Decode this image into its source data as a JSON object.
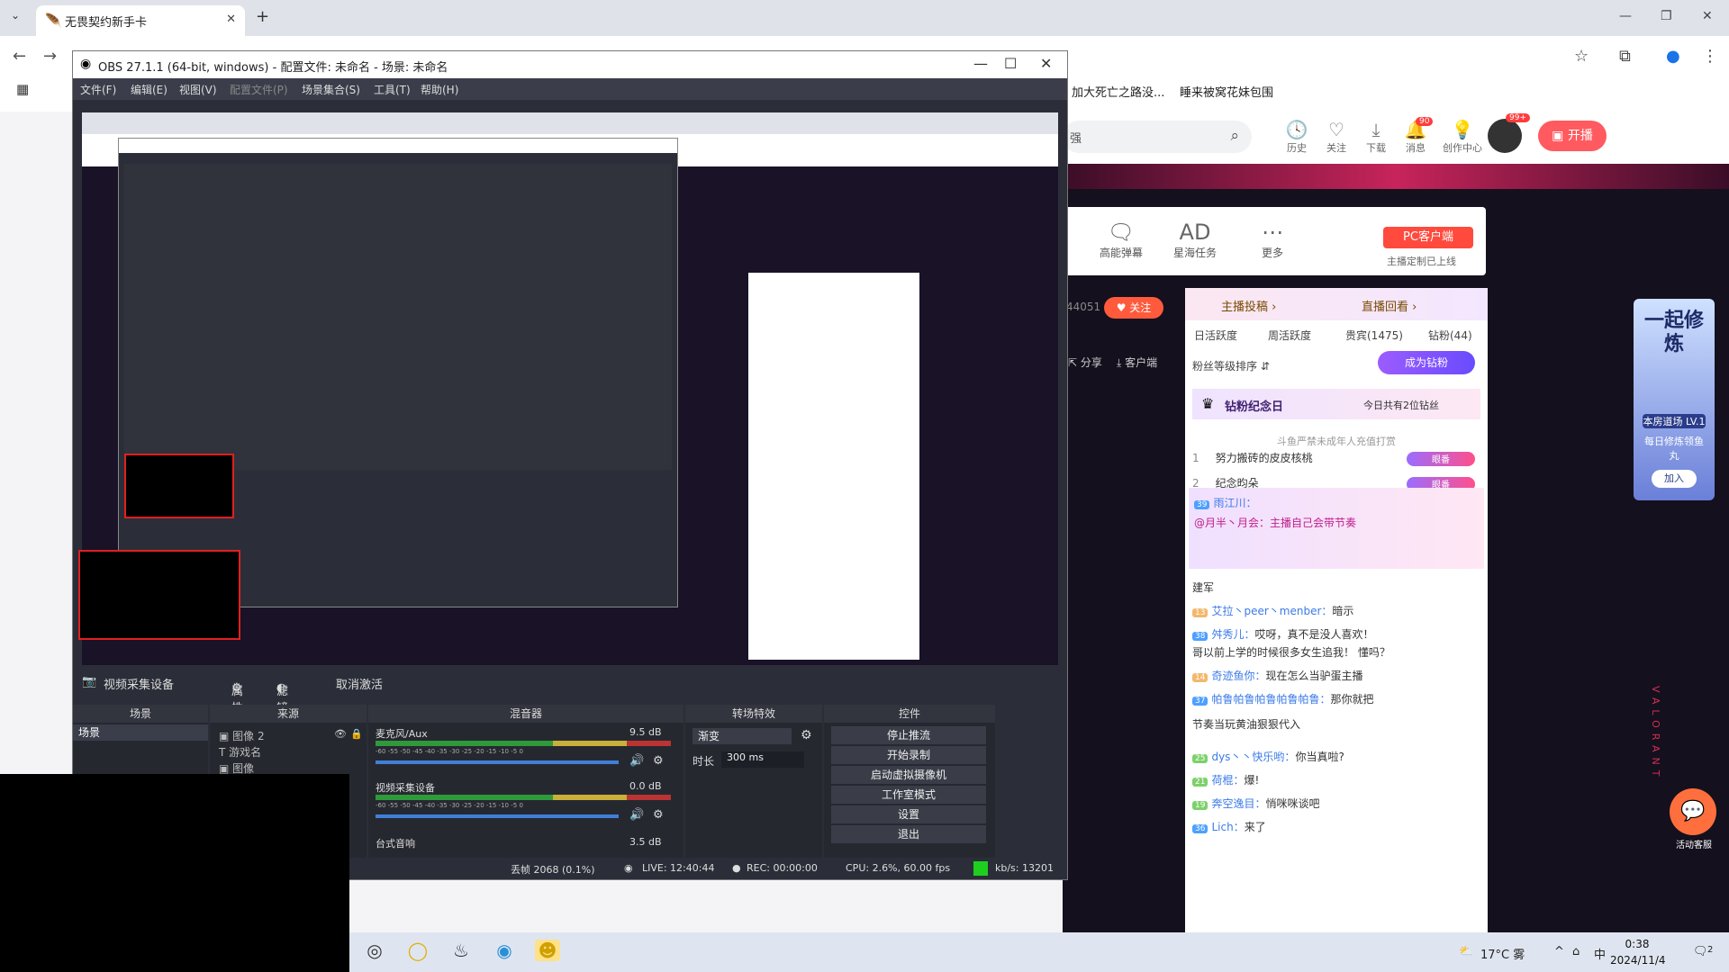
{
  "browser": {
    "tab_title": "无畏契约新手卡",
    "bookmarks": [
      "加大死亡之路没...",
      "睡来被窝花妹包围"
    ],
    "win_min": "—",
    "win_max": "❐",
    "win_close": "✕"
  },
  "douyu": {
    "search_text": "强",
    "header_icons": [
      {
        "glyph": "🕓",
        "label": "历史"
      },
      {
        "glyph": "♡",
        "label": "关注"
      },
      {
        "glyph": "⤓",
        "label": "下载"
      },
      {
        "glyph": "🔔",
        "label": "消息",
        "badge": "90"
      },
      {
        "glyph": "💡",
        "label": "创作中心"
      }
    ],
    "avatar_badge": "99+",
    "open_button": "开播",
    "toolbox": [
      {
        "glyph": "🗨",
        "label": "高能弹幕"
      },
      {
        "glyph": "AD",
        "label": "星海任务"
      },
      {
        "glyph": "⋯",
        "label": "更多"
      }
    ],
    "pc_client_button": "PC客户端",
    "pc_client_sub": "主播定制已上线",
    "follow_count": "44051",
    "follow_button": "关注",
    "share": "分享",
    "client": "客户端",
    "chat": {
      "head_left": "主播投稿 ›",
      "head_right": "直播回看 ›",
      "tabs": [
        "日活跃度",
        "周活跃度",
        "贵宾(1475)",
        "钻粉(44)"
      ],
      "fan_sort": "粉丝等级排序 ⇵",
      "become_diamond": "成为钻粉",
      "anniversary": "钻粉纪念日",
      "anniversary_note": "今日共有2位钻丝",
      "notice": "斗鱼严禁未成年人充值打赏",
      "ranks": [
        {
          "n": "1",
          "name": "努力搬砖的皮皮核桃",
          "badge": "眼番"
        },
        {
          "n": "2",
          "name": "纪念昀朵",
          "badge": "眼番"
        }
      ],
      "highlight_level": "39",
      "highlight_user": "雨江川：",
      "highlight_text": "@月半丶月会：主播自己会带节奏",
      "messages": [
        {
          "level": "",
          "user": "",
          "text": "建军"
        },
        {
          "level": "13",
          "user": "艾拉丶peer丶menber：",
          "text": "暗示"
        },
        {
          "level": "38",
          "user": "舛秀儿：",
          "text": "哎呀，真不是没人喜欢！"
        },
        {
          "level": "",
          "user": "",
          "text": "哥以前上学的时候很多女生追我！ 懂吗？"
        },
        {
          "level": "14",
          "user": "奇迹鱼你：",
          "text": "现在怎么当驴蛋主播"
        },
        {
          "level": "37",
          "user": "帕鲁帕鲁帕鲁帕鲁帕鲁：",
          "text": "那你就把"
        },
        {
          "level": "",
          "user": "",
          "text": "节奏当玩黄油狠狠代入"
        },
        {
          "level": "25",
          "user": "dys丶丶快乐哟：",
          "text": "你当真啦?"
        },
        {
          "level": "21",
          "user": "荷棍：",
          "text": "爆!"
        },
        {
          "level": "19",
          "user": "奔空逸目：",
          "text": "悄咪咪谈吧"
        },
        {
          "level": "36",
          "user": "Lich：",
          "text": "来了"
        }
      ]
    },
    "promo": {
      "title": "一起修炼",
      "badge": "本房道场 LV.1",
      "sub": "每日修炼领鱼丸",
      "join": "加入"
    },
    "cs_label": "活动客服"
  },
  "obs": {
    "title": "OBS 27.1.1 (64-bit, windows) - 配置文件: 未命名 - 场景: 未命名",
    "menu": [
      "文件(F)",
      "编辑(E)",
      "视图(V)",
      "配置文件(P)",
      "场景集合(S)",
      "工具(T)",
      "帮助(H)"
    ],
    "device_label": "视频采集设备",
    "properties": "属性",
    "filters": "滤镜",
    "deactivate": "取消激活",
    "docks": {
      "scenes": "场景",
      "sources": "来源",
      "mixer": "混音器",
      "transitions": "转场特效",
      "controls": "控件"
    },
    "scene_item": "场景",
    "sources": [
      "图像 2",
      "游戏名",
      "图像"
    ],
    "mixer": [
      {
        "name": "麦克风/Aux",
        "db": "9.5 dB"
      },
      {
        "name": "视频采集设备",
        "db": "0.0 dB"
      },
      {
        "name": "台式音响",
        "db": "3.5 dB"
      }
    ],
    "meter_scale": "-60  -55  -50  -45  -40  -35  -30  -25  -20  -15  -10  -5  0",
    "transition": "渐变",
    "duration_label": "时长",
    "duration": "300 ms",
    "controls": [
      "停止推流",
      "开始录制",
      "启动虚拟摄像机",
      "工作室模式",
      "设置",
      "退出"
    ],
    "status": {
      "dropped": "丢帧 2068 (0.1%)",
      "live": "LIVE: 12:40:44",
      "rec": "REC: 00:00:00",
      "cpu": "CPU: 2.6%, 60.00 fps",
      "kbs": "kb/s: 13201"
    }
  },
  "taskbar": {
    "weather": "17°C 雾",
    "ime": "中",
    "time": "0:38",
    "date": "2024/11/4",
    "notif": "2"
  },
  "valorant_text": "VALORANT"
}
